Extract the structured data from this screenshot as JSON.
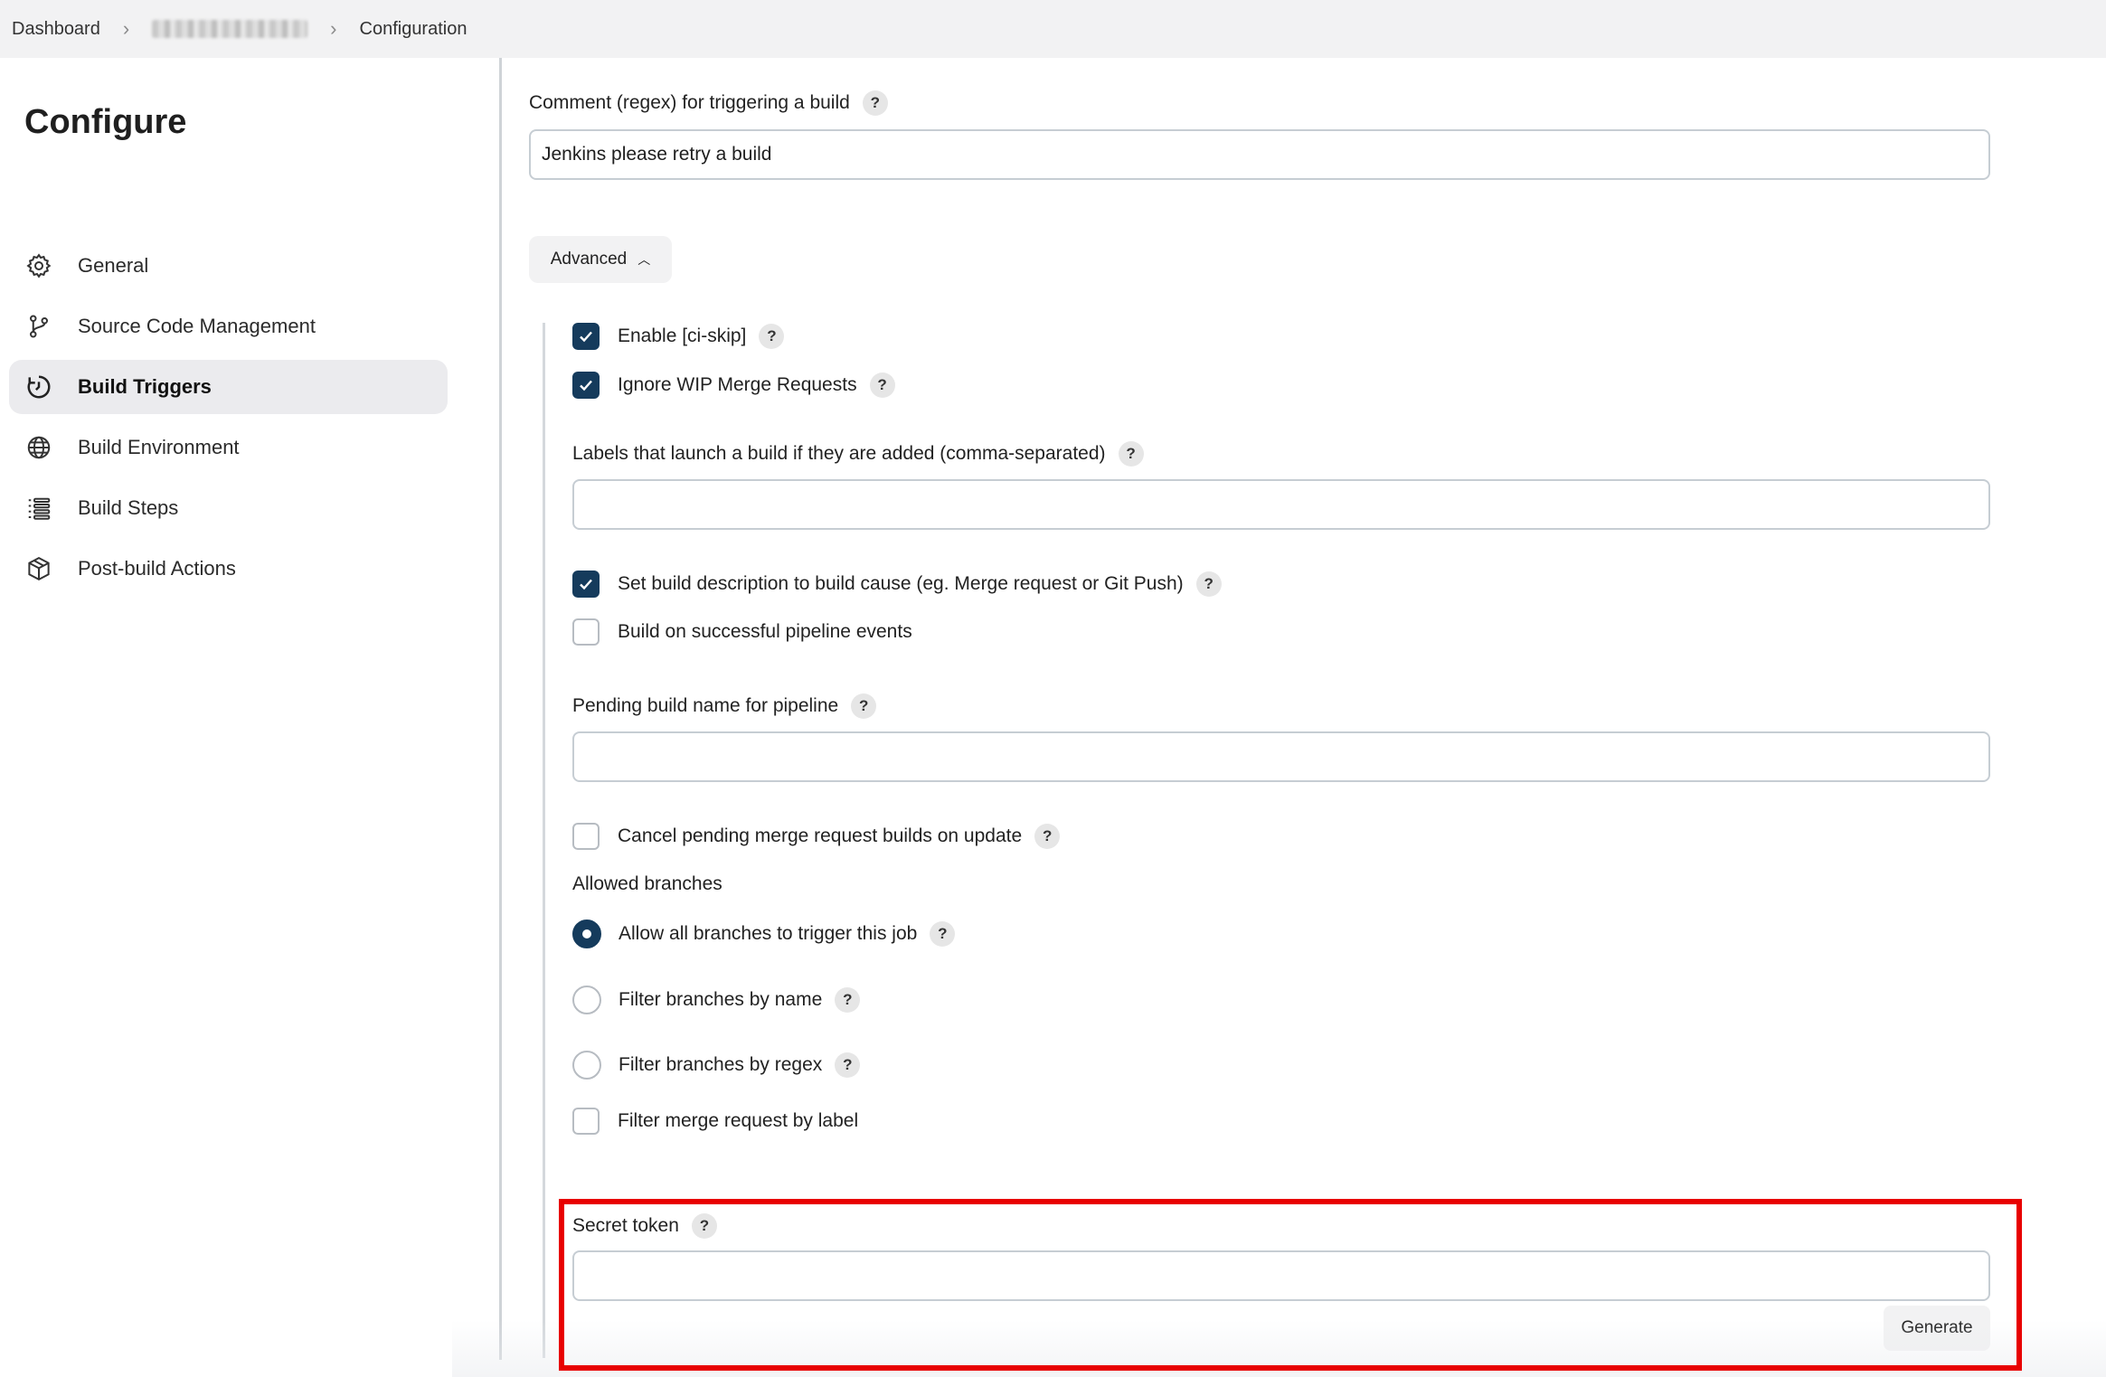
{
  "breadcrumb": {
    "items": [
      "Dashboard",
      "",
      "Configuration"
    ]
  },
  "sidebar": {
    "title": "Configure",
    "items": [
      {
        "label": "General",
        "icon": "gear-icon",
        "active": false
      },
      {
        "label": "Source Code Management",
        "icon": "branch-icon",
        "active": false
      },
      {
        "label": "Build Triggers",
        "icon": "clock-icon",
        "active": true
      },
      {
        "label": "Build Environment",
        "icon": "globe-icon",
        "active": false
      },
      {
        "label": "Build Steps",
        "icon": "list-icon",
        "active": false
      },
      {
        "label": "Post-build Actions",
        "icon": "package-icon",
        "active": false
      }
    ]
  },
  "form": {
    "comment_regex": {
      "label": "Comment (regex) for triggering a build",
      "value": "Jenkins please retry a build"
    },
    "advanced_label": "Advanced",
    "enable_ci_skip": {
      "label": "Enable [ci-skip]",
      "checked": true
    },
    "ignore_wip": {
      "label": "Ignore WIP Merge Requests",
      "checked": true
    },
    "labels_launch": {
      "label": "Labels that launch a build if they are added (comma-separated)",
      "value": ""
    },
    "set_build_description": {
      "label": "Set build description to build cause (eg. Merge request or Git Push)",
      "checked": true
    },
    "build_on_pipeline": {
      "label": "Build on successful pipeline events",
      "checked": false
    },
    "pending_build_name": {
      "label": "Pending build name for pipeline",
      "value": ""
    },
    "cancel_pending": {
      "label": "Cancel pending merge request builds on update",
      "checked": false
    },
    "allowed_branches": {
      "label": "Allowed branches",
      "options": [
        {
          "label": "Allow all branches to trigger this job",
          "selected": true
        },
        {
          "label": "Filter branches by name",
          "selected": false
        },
        {
          "label": "Filter branches by regex",
          "selected": false
        }
      ]
    },
    "filter_merge_by_label": {
      "label": "Filter merge request by label",
      "checked": false
    },
    "secret_token": {
      "label": "Secret token",
      "value": ""
    },
    "generate_label": "Generate",
    "help_glyph": "?"
  },
  "colors": {
    "accent": "#153b5c",
    "highlight": "#e80000",
    "active_nav_bg": "#ebebee"
  }
}
